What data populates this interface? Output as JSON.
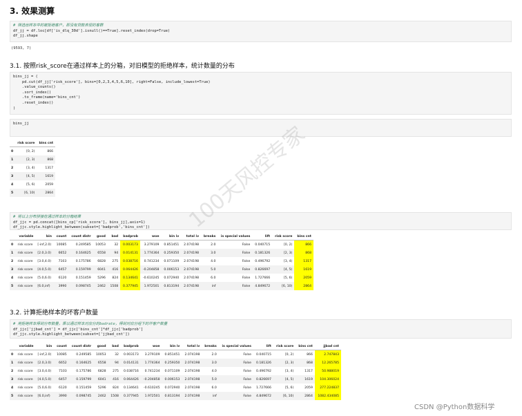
{
  "heading": "3. 效果测算",
  "cell1": {
    "comment": "# 筛选出样本中的被拒绝客户，即没有贷款表现的客群",
    "line1": "df_jj = df.loc[df['is_dlq_30d'].isnull()==True].reset_index(drop=True)",
    "line2": "df_jj.shape"
  },
  "cell1_output": "(9593, 7)",
  "subheading1": "3.1. 按照risk_score在通过样本上的分箱，对旧模型的拒绝样本，统计数量的分布",
  "cell2": {
    "l1": "bins_jj = (",
    "l2": "    pd.cut(df_jj['risk_score'], bins=[0,2,3,4,5,6,10], right=False, include_lowest=True)",
    "l3": "    .value_counts()",
    "l4": "    .sort_index()",
    "l5": "    .to_frame(name='bins_cnt')",
    "l6": "    .reset_index()",
    "l7": ")"
  },
  "cell3": {
    "line1": "bins_jj"
  },
  "bins_table": {
    "columns": [
      "risk score",
      "bins cnt"
    ],
    "rows": [
      [
        "0",
        "[0, 2)",
        "866"
      ],
      [
        "1",
        "[2, 3)",
        "868"
      ],
      [
        "2",
        "[3, 4)",
        "1317"
      ],
      [
        "3",
        "[4, 5)",
        "1619"
      ],
      [
        "4",
        "[5, 6)",
        "2059"
      ],
      [
        "5",
        "[6, 10)",
        "2864"
      ]
    ]
  },
  "cell4": {
    "comment": "# 将以上分布拼接在通过样本的分箱结果",
    "line1": "df_jjc = pd.concat([bins_cp['risk_score'], bins_jj],axis=1)",
    "line2": "df_jjc.style.highlight_between(subset=['badprob','bins_cnt'])"
  },
  "table1": {
    "columns": [
      "variable",
      "bin",
      "count",
      "count distr",
      "good",
      "bad",
      "badprob",
      "woe",
      "bin iv",
      "total iv",
      "breaks",
      "is special values",
      "lift",
      "risk score",
      "bins cnt"
    ],
    "rows": [
      [
        "0",
        "risk score",
        "[-inf,2.0)",
        "10085",
        "0.249585",
        "10053",
        "32",
        "0.003173",
        "3.279109",
        "0.851451",
        "2.074198",
        "2.0",
        "False",
        "0.040715",
        "[0, 2)",
        "866"
      ],
      [
        "1",
        "risk score",
        "[2.0,3.0)",
        "6652",
        "0.164625",
        "6558",
        "94",
        "0.014131",
        "1.774364",
        "0.259350",
        "2.074198",
        "3.0",
        "False",
        "0.181326",
        "[2, 3)",
        "868"
      ],
      [
        "2",
        "risk score",
        "[3.0,4.0)",
        "7103",
        "0.175786",
        "6828",
        "275",
        "0.038716",
        "0.741234",
        "0.071109",
        "2.074198",
        "4.0",
        "False",
        "0.496792",
        "[3, 4)",
        "1317"
      ],
      [
        "3",
        "risk score",
        "[4.0,5.0)",
        "6457",
        "0.159799",
        "6041",
        "416",
        "0.064426",
        "-0.204858",
        "0.006153",
        "2.074198",
        "5.0",
        "False",
        "0.826697",
        "[4, 5)",
        "1619"
      ],
      [
        "4",
        "risk score",
        "[5.0,6.0)",
        "6120",
        "0.151459",
        "5296",
        "824",
        "0.134641",
        "-0.610245",
        "0.072940",
        "2.074198",
        "6.0",
        "False",
        "1.727666",
        "[5, 6)",
        "2059"
      ],
      [
        "5",
        "risk score",
        "[6.0,inf)",
        "3990",
        "0.098745",
        "2462",
        "1508",
        "0.377945",
        "1.972501",
        "0.813194",
        "2.074198",
        "inf",
        "False",
        "4.849672",
        "[6, 10)",
        "2864"
      ]
    ]
  },
  "subheading2": "3.2. 计算拒绝样本的坏客户数量",
  "cell5": {
    "comment": "# 用拒绝样本得到分布数量，乘以通过样本对应分的badrate，得到对应分组下的坏客户数量",
    "line1": "df_jjc['jjbad_cnt'] = df_jjc['bins_cnt']*df_jjc['badprob']",
    "line2": "df_jjc.style.highlight_between(subset=['jjbad_cnt'])"
  },
  "table2": {
    "columns": [
      "variable",
      "bin",
      "count",
      "count distr",
      "good",
      "bad",
      "badprob",
      "woe",
      "bin iv",
      "total iv",
      "breaks",
      "is special values",
      "lift",
      "risk score",
      "bins cnt",
      "jjbad cnt"
    ],
    "rows": [
      [
        "0",
        "risk score",
        "[-inf,2.0)",
        "10085",
        "0.249585",
        "10053",
        "32",
        "0.003173",
        "3.279109",
        "0.851451",
        "2.074198",
        "2.0",
        "False",
        "0.040715",
        "[0, 2)",
        "866",
        "2.747843"
      ],
      [
        "1",
        "risk score",
        "[2.0,3.0)",
        "6652",
        "0.164625",
        "6558",
        "94",
        "0.014131",
        "1.774364",
        "0.259350",
        "2.074198",
        "3.0",
        "False",
        "0.181326",
        "[2, 3)",
        "868",
        "12.265785"
      ],
      [
        "2",
        "risk score",
        "[3.0,4.0)",
        "7103",
        "0.175786",
        "6828",
        "275",
        "0.038716",
        "0.741234",
        "0.071109",
        "2.074198",
        "4.0",
        "False",
        "0.496792",
        "[3, 4)",
        "1317",
        "50.988019"
      ],
      [
        "3",
        "risk score",
        "[4.0,5.0)",
        "6457",
        "0.159799",
        "6041",
        "416",
        "0.064426",
        "-0.204858",
        "0.006153",
        "2.074198",
        "5.0",
        "False",
        "0.826697",
        "[4, 5)",
        "1619",
        "104.306024"
      ],
      [
        "4",
        "risk score",
        "[5.0,6.0)",
        "6120",
        "0.151459",
        "5296",
        "824",
        "0.134641",
        "-0.610245",
        "0.072940",
        "2.074198",
        "6.0",
        "False",
        "1.727666",
        "[5, 6)",
        "2059",
        "277.224837"
      ],
      [
        "5",
        "risk score",
        "[6.0,inf)",
        "3990",
        "0.098745",
        "2462",
        "1508",
        "0.377945",
        "1.972501",
        "0.813194",
        "2.074198",
        "inf",
        "False",
        "4.849672",
        "[6, 10)",
        "2864",
        "1082.434085"
      ]
    ]
  },
  "watermark": "100天风控专家",
  "footer": "CSDN @Python数据科学",
  "colors": {
    "highlight": "#ffff00",
    "cell_bg": "#f5f5f5",
    "comment": "#3a8a6a"
  }
}
